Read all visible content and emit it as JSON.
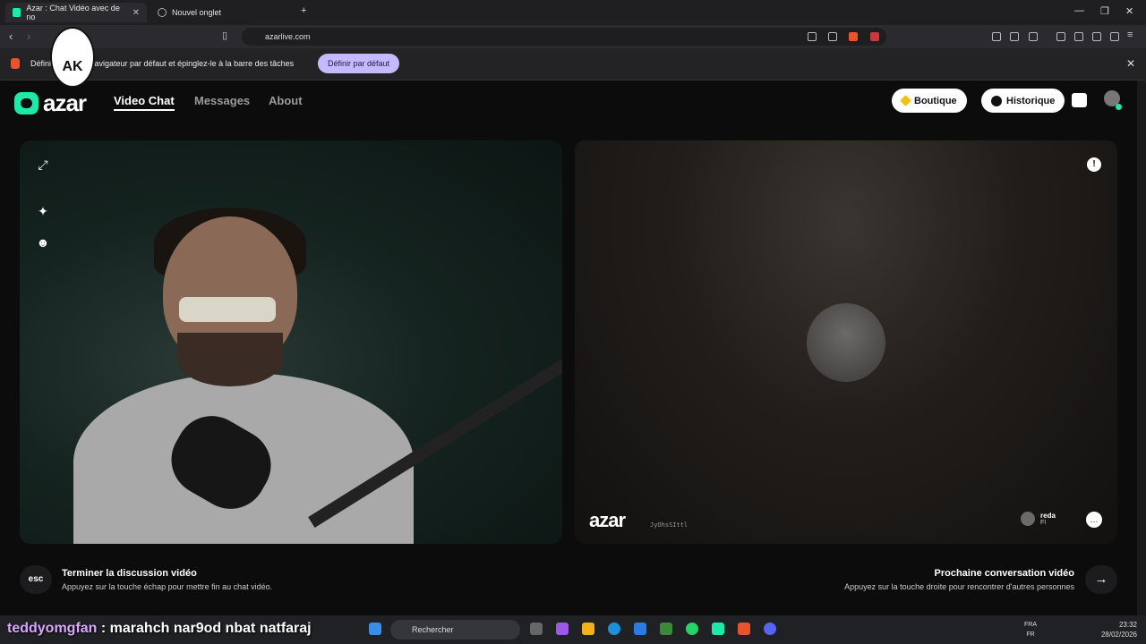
{
  "browser": {
    "tabs": [
      {
        "label": "Azar : Chat Vidéo avec de no",
        "active": true
      },
      {
        "label": "Nouvel onglet",
        "active": false
      }
    ],
    "new_tab": "+",
    "url": "azarlive.com",
    "infobar": {
      "text": "Défini… comme navigateur par défaut et épinglez-le à la barre des tâches",
      "button": "Définir par défaut",
      "close": "✕"
    }
  },
  "azar": {
    "logo": "azar",
    "nav": [
      "Video Chat",
      "Messages",
      "About"
    ],
    "shop_button": "Boutique",
    "history_button": "Historique",
    "accent_color": "#1de9a8"
  },
  "remote": {
    "watermark": "azar",
    "session_id": "JyOhsSIttl",
    "peer_name": "reda",
    "peer_country": "FI"
  },
  "controls": {
    "esc_key": "esc",
    "end_title": "Terminer la discussion vidéo",
    "end_sub": "Appuyez sur la touche échap pour mettre fin au chat vidéo.",
    "next_title": "Prochaine conversation vidéo",
    "next_sub": "Appuyez sur la touche droite pour rencontrer d'autres personnes",
    "next_arrow": "→"
  },
  "overlay": {
    "user": "teddyomgfan",
    "message": ": marahch nar9od nbat natfaraj"
  },
  "stream_logo_text": "AK",
  "taskbar": {
    "search": "Rechercher",
    "lang_top": "FRA",
    "lang_bottom": "FR",
    "time": "23:32",
    "date": "28/02/2026"
  }
}
